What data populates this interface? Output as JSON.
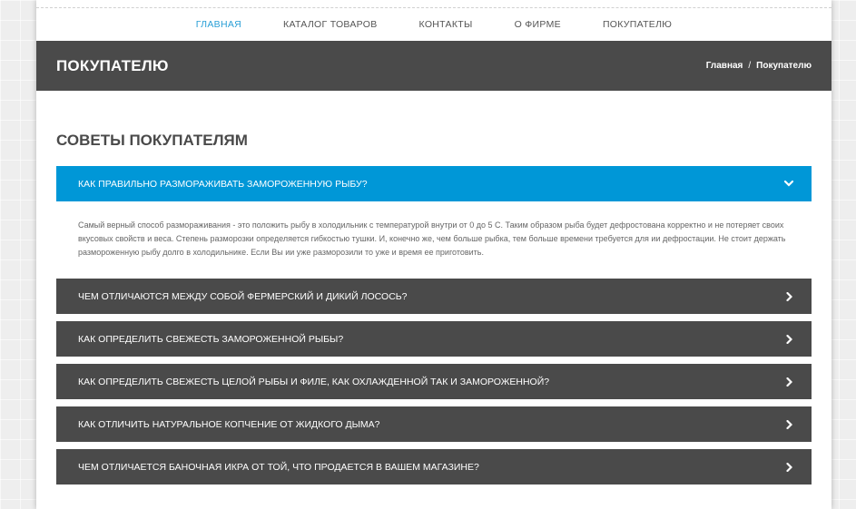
{
  "nav": {
    "items": [
      {
        "label": "ГЛАВНАЯ",
        "active": true
      },
      {
        "label": "КАТАЛОГ ТОВАРОВ",
        "active": false
      },
      {
        "label": "КОНТАКТЫ",
        "active": false
      },
      {
        "label": "О ФИРМЕ",
        "active": false
      },
      {
        "label": "ПОКУПАТЕЛЮ",
        "active": false
      }
    ]
  },
  "header": {
    "title": "ПОКУПАТЕЛЮ",
    "breadcrumb": {
      "home": "Главная",
      "separator": "/",
      "current": "Покупателю"
    }
  },
  "main": {
    "heading": "СОВЕТЫ ПОКУПАТЕЛЯМ",
    "faq": [
      {
        "question": "КАК ПРАВИЛЬНО РАЗМОРАЖИВАТЬ ЗАМОРОЖЕННУЮ РЫБУ?",
        "expanded": true,
        "answer": "Самый верный способ размораживания - это положить рыбу в холодильник с температурой внутри от 0 до 5 С. Таким образом рыба будет дефростована корректно и не потеряет своих вкусовых свойств и веса. Степень разморозки определяется гибкостью тушки. И, конечно же, чем больше рыбка, тем больше времени требуется для ии дефростации. Не стоит держать размороженную рыбу долго в холодильнике. Если Вы ии уже разморозили то уже и время ее приготовить."
      },
      {
        "question": "ЧЕМ ОТЛИЧАЮТСЯ МЕЖДУ СОБОЙ ФЕРМЕРСКИЙ И ДИКИЙ ЛОСОСЬ?",
        "expanded": false
      },
      {
        "question": "КАК ОПРЕДЕЛИТЬ СВЕЖЕСТЬ ЗАМОРОЖЕННОЙ РЫБЫ?",
        "expanded": false
      },
      {
        "question": "КАК ОПРЕДЕЛИТЬ СВЕЖЕСТЬ ЦЕЛОЙ РЫБЫ И ФИЛЕ, КАК ОХЛАЖДЕННОЙ ТАК И ЗАМОРОЖЕННОЙ?",
        "expanded": false
      },
      {
        "question": "КАК ОТЛИЧИТЬ НАТУРАЛЬНОЕ КОПЧЕНИЕ ОТ ЖИДКОГО ДЫМА?",
        "expanded": false
      },
      {
        "question": "ЧЕМ ОТЛИЧАЕТСЯ БАНОЧНАЯ ИКРА ОТ ТОЙ, ЧТО ПРОДАЕТСЯ В ВАШЕМ МАГАЗИНЕ?",
        "expanded": false
      }
    ]
  },
  "colors": {
    "accent": "#0097d7",
    "nav_active": "#2a9fd6",
    "dark_bar": "#4a4a4a"
  },
  "icons": {
    "expanded": "chevron-down-icon",
    "collapsed": "chevron-right-icon"
  }
}
